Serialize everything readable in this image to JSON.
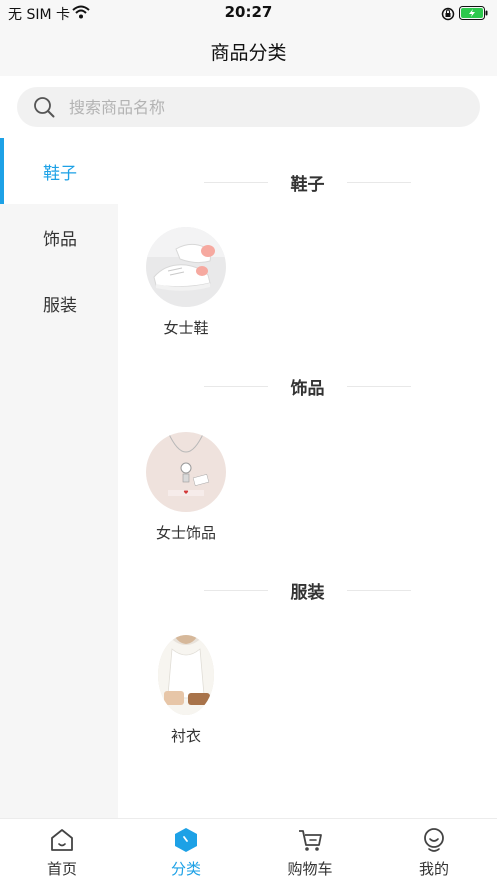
{
  "status_bar": {
    "carrier": "无 SIM 卡",
    "time": "20:27"
  },
  "header": {
    "title": "商品分类"
  },
  "search": {
    "placeholder": "搜索商品名称",
    "value": ""
  },
  "sidebar": {
    "items": [
      {
        "label": "鞋子",
        "active": true
      },
      {
        "label": "饰品",
        "active": false
      },
      {
        "label": "服装",
        "active": false
      }
    ]
  },
  "sections": [
    {
      "title": "鞋子",
      "products": [
        {
          "name": "女士鞋"
        }
      ]
    },
    {
      "title": "饰品",
      "products": [
        {
          "name": "女士饰品"
        }
      ]
    },
    {
      "title": "服装",
      "products": [
        {
          "name": "衬衣"
        }
      ]
    }
  ],
  "tab_bar": {
    "items": [
      {
        "label": "首页",
        "icon": "home-icon"
      },
      {
        "label": "分类",
        "icon": "category-icon",
        "active": true
      },
      {
        "label": "购物车",
        "icon": "cart-icon"
      },
      {
        "label": "我的",
        "icon": "profile-icon"
      }
    ]
  },
  "colors": {
    "accent": "#1da1e6",
    "sidebar_bg": "#f6f6f6",
    "bar_bg": "#f7f7f7"
  }
}
